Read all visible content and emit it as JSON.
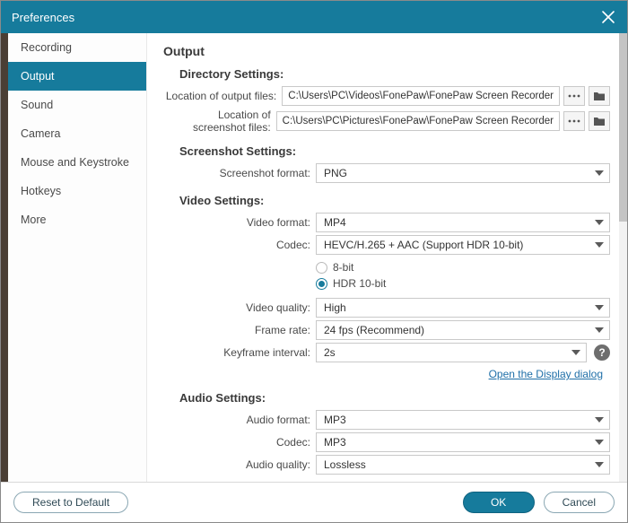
{
  "titlebar": {
    "title": "Preferences"
  },
  "sidebar": {
    "items": [
      {
        "label": "Recording"
      },
      {
        "label": "Output"
      },
      {
        "label": "Sound"
      },
      {
        "label": "Camera"
      },
      {
        "label": "Mouse and Keystroke"
      },
      {
        "label": "Hotkeys"
      },
      {
        "label": "More"
      }
    ],
    "active_index": 1
  },
  "content": {
    "heading": "Output",
    "directory": {
      "title": "Directory Settings:",
      "output_label": "Location of output files:",
      "output_path": "C:\\Users\\PC\\Videos\\FonePaw\\FonePaw Screen Recorder",
      "screenshot_label": "Location of screenshot files:",
      "screenshot_path": "C:\\Users\\PC\\Pictures\\FonePaw\\FonePaw Screen Recorder"
    },
    "screenshot": {
      "title": "Screenshot Settings:",
      "format_label": "Screenshot format:",
      "format_value": "PNG"
    },
    "video": {
      "title": "Video Settings:",
      "format_label": "Video format:",
      "format_value": "MP4",
      "codec_label": "Codec:",
      "codec_value": "HEVC/H.265 + AAC (Support HDR 10-bit)",
      "bit_8": "8-bit",
      "bit_hdr": "HDR 10-bit",
      "quality_label": "Video quality:",
      "quality_value": "High",
      "framerate_label": "Frame rate:",
      "framerate_value": "24 fps (Recommend)",
      "keyframe_label": "Keyframe interval:",
      "keyframe_value": "2s",
      "display_link": "Open the Display dialog"
    },
    "audio": {
      "title": "Audio Settings:",
      "format_label": "Audio format:",
      "format_value": "MP3",
      "codec_label": "Codec:",
      "codec_value": "MP3",
      "quality_label": "Audio quality:",
      "quality_value": "Lossless"
    }
  },
  "footer": {
    "reset": "Reset to Default",
    "ok": "OK",
    "cancel": "Cancel"
  }
}
